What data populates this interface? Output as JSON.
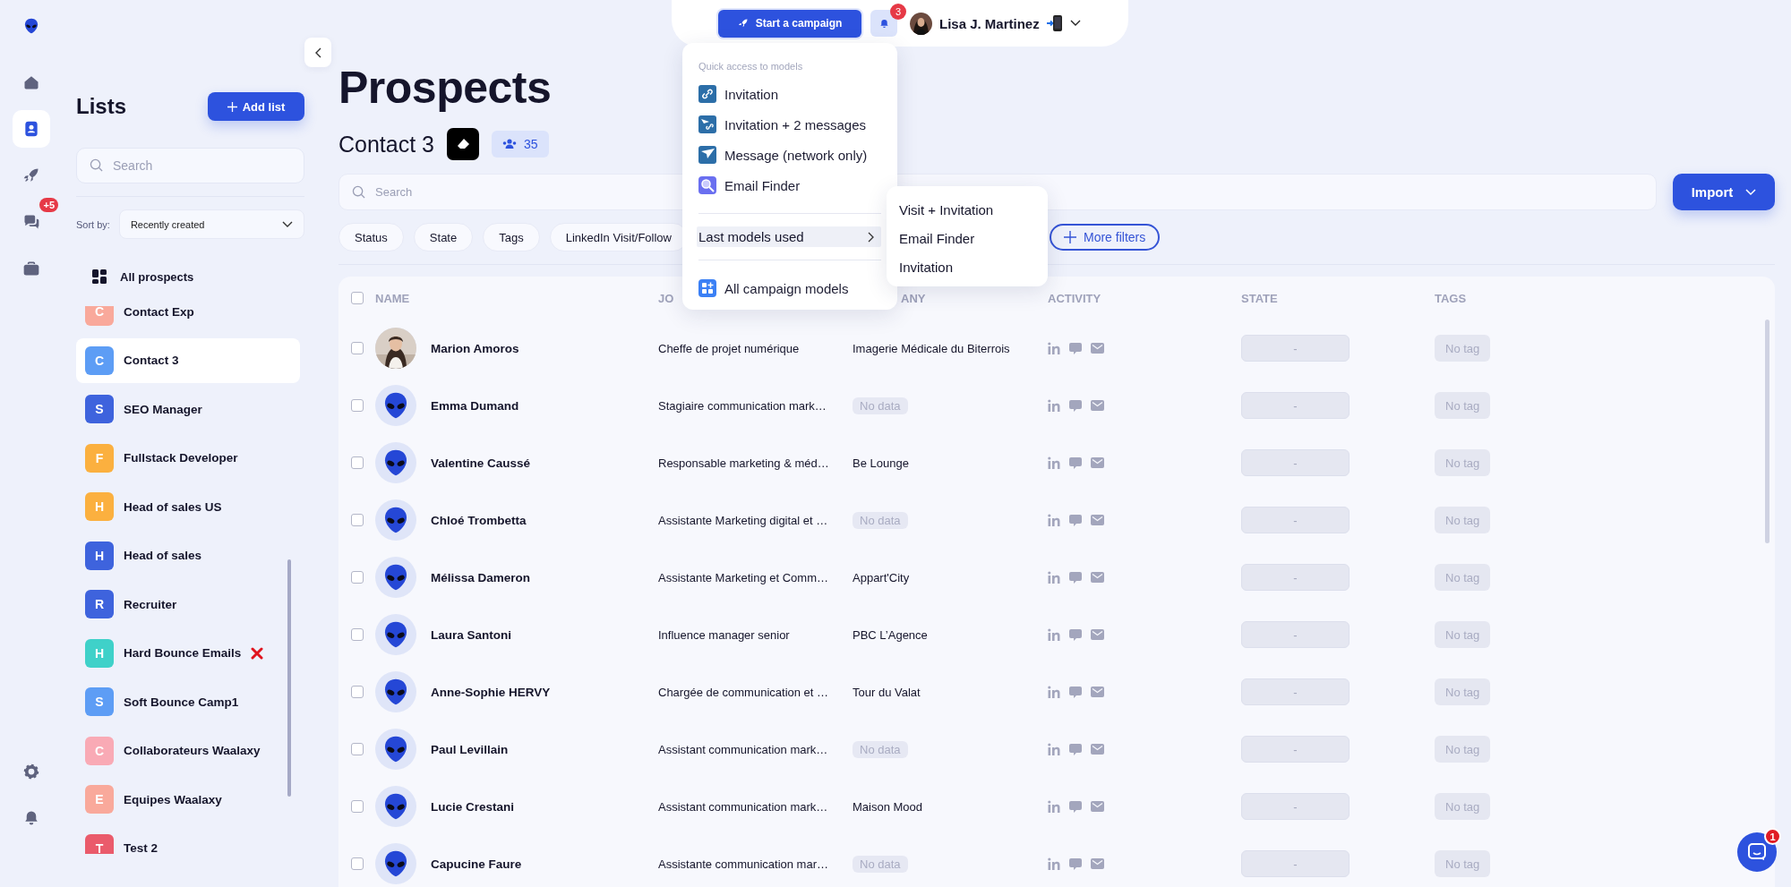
{
  "nav": {
    "items": [
      {
        "kind": "home",
        "selected": false
      },
      {
        "kind": "contacts",
        "selected": true
      },
      {
        "kind": "rocket",
        "selected": false
      },
      {
        "kind": "chat",
        "selected": false,
        "badge": "+5"
      },
      {
        "kind": "briefcase",
        "selected": false
      }
    ],
    "bottom_items": [
      {
        "kind": "settings"
      },
      {
        "kind": "bell"
      }
    ]
  },
  "lists_panel": {
    "title": "Lists",
    "add_button": "Add list",
    "search": {
      "placeholder": "Search"
    },
    "sort": {
      "label": "Sort by:",
      "value": "Recently created"
    },
    "all_prospects": "All prospects",
    "items": [
      {
        "kind": "plain",
        "initial": "C",
        "name": "Contact Exp",
        "color": "#f9a99b",
        "selected": false
      },
      {
        "kind": "plain",
        "initial": "C",
        "name": "Contact 3",
        "color": "#5d9df5",
        "selected": true
      },
      {
        "kind": "plain",
        "initial": "S",
        "name": "SEO Manager",
        "color": "#3e63dd",
        "selected": false
      },
      {
        "kind": "plain",
        "initial": "F",
        "name": "Fullstack Developer",
        "color": "#fbb03f",
        "selected": false
      },
      {
        "kind": "plain",
        "initial": "H",
        "name": "Head of sales US",
        "color": "#fbb03f",
        "selected": false
      },
      {
        "kind": "plain",
        "initial": "H",
        "name": "Head of sales",
        "color": "#3e63dd",
        "selected": false
      },
      {
        "kind": "plain",
        "initial": "R",
        "name": "Recruiter",
        "color": "#3e63dd",
        "selected": false
      },
      {
        "kind": "crossed",
        "initial": "H",
        "name": "Hard Bounce Emails",
        "color": "#3fd1c9",
        "selected": false
      },
      {
        "kind": "plain",
        "initial": "S",
        "name": "Soft Bounce Camp1",
        "color": "#5d9df5",
        "selected": false
      },
      {
        "kind": "plain",
        "initial": "C",
        "name": "Collaborateurs Waalaxy",
        "color": "#f9aab5",
        "selected": false
      },
      {
        "kind": "plain",
        "initial": "E",
        "name": "Equipes Waalaxy",
        "color": "#f9a99b",
        "selected": false
      },
      {
        "kind": "plain",
        "initial": "T",
        "name": "Test 2",
        "color": "#ea5b6b",
        "selected": false
      }
    ]
  },
  "top_bar": {
    "campaign_button": "Start a campaign",
    "notifications": "3",
    "user_name": "Lisa J. Martinez"
  },
  "models_menu": {
    "section_title": "Quick access to models",
    "items": [
      {
        "label": "Invitation",
        "kind": "link"
      },
      {
        "label": "Invitation + 2 messages",
        "kind": "combo"
      },
      {
        "label": "Message (network only)",
        "kind": "message"
      },
      {
        "label": "Email Finder",
        "kind": "finder"
      }
    ],
    "last_used": {
      "label": "Last models used",
      "expanded": true,
      "items": [
        "Visit + Invitation",
        "Email Finder",
        "Invitation"
      ]
    },
    "all_models": "All campaign models"
  },
  "prospects": {
    "title": "Prospects",
    "list_name": "Contact 3",
    "count": "35",
    "search": {
      "placeholder": "Search"
    },
    "import_button": "Import",
    "filters": [
      "Status",
      "State",
      "Tags",
      "LinkedIn Visit/Follow"
    ],
    "more_filters": "More filters",
    "table": {
      "select_all_checked": false,
      "columns": [
        "NAME",
        "JO",
        "ANY",
        "ACTIVITY",
        "STATE",
        "TAGS"
      ],
      "rows": [
        {
          "checked": false,
          "name": "Marion Amoros",
          "job": "Cheffe de projet numérique",
          "company": "Imagerie Médicale du Biterrois",
          "company_missing": false,
          "state": "-",
          "tags": "No tag"
        },
        {
          "kind": "alien",
          "checked": false,
          "name": "Emma Dumand",
          "job": "Stagiaire communication mark…",
          "company": "No data",
          "company_missing": true,
          "state": "-",
          "tags": "No tag"
        },
        {
          "kind": "alien",
          "checked": false,
          "name": "Valentine Caussé",
          "job": "Responsable marketing & méd…",
          "company": "Be Lounge",
          "company_missing": false,
          "state": "-",
          "tags": "No tag"
        },
        {
          "kind": "alien",
          "checked": false,
          "name": "Chloé Trombetta",
          "job": "Assistante Marketing digital et …",
          "company": "No data",
          "company_missing": true,
          "state": "-",
          "tags": "No tag"
        },
        {
          "kind": "alien",
          "checked": false,
          "name": "Mélissa Dameron",
          "job": "Assistante Marketing et Comm…",
          "company": "Appart'City",
          "company_missing": false,
          "state": "-",
          "tags": "No tag"
        },
        {
          "kind": "alien",
          "checked": false,
          "name": "Laura Santoni",
          "job": "Influence manager senior",
          "company": "PBC L’Agence",
          "company_missing": false,
          "state": "-",
          "tags": "No tag"
        },
        {
          "kind": "alien",
          "checked": false,
          "name": "Anne-Sophie HERVY",
          "job": "Chargée de communication et …",
          "company": "Tour du Valat",
          "company_missing": false,
          "state": "-",
          "tags": "No tag"
        },
        {
          "kind": "alien",
          "checked": false,
          "name": "Paul Levillain",
          "job": "Assistant communication mark…",
          "company": "No data",
          "company_missing": true,
          "state": "-",
          "tags": "No tag"
        },
        {
          "kind": "alien",
          "checked": false,
          "name": "Lucie Crestani",
          "job": "Assistant communication mark…",
          "company": "Maison Mood",
          "company_missing": false,
          "state": "-",
          "tags": "No tag"
        },
        {
          "kind": "alien",
          "checked": false,
          "name": "Capucine Faure",
          "job": "Assistante communication mar…",
          "company": "No data",
          "company_missing": true,
          "state": "-",
          "tags": "No tag"
        }
      ]
    }
  },
  "chat_launcher": {
    "badge": "1"
  }
}
